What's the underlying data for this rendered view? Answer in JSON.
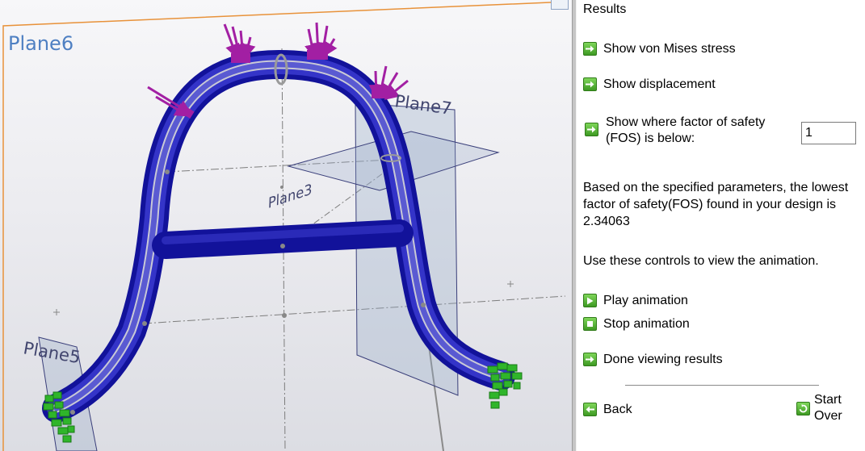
{
  "viewport": {
    "planes": {
      "plane6": "Plane6",
      "plane7": "Plane7",
      "plane5": "Plane5",
      "plane_top": "Plane3"
    }
  },
  "panel": {
    "title": "Results",
    "show_stress": "Show von Mises stress",
    "show_displacement": "Show displacement",
    "fos_label_line1": "Show where factor of safety",
    "fos_label_line2": "(FOS) is below:",
    "fos_value": "1",
    "result_text": "Based on the specified parameters, the lowest factor of safety(FOS) found in your design is 2.34063",
    "animation_hint": "Use these controls to view the animation.",
    "play": "Play animation",
    "stop": "Stop animation",
    "done": "Done viewing results",
    "back": "Back",
    "start_over_line1": "Start",
    "start_over_line2": "Over"
  },
  "colors": {
    "beam": "#1a1aa8",
    "load_arrows": "#a21fa3",
    "fixtures": "#2fb52a",
    "plane_border": "#e8923a",
    "button_green": "#3e9a23"
  }
}
